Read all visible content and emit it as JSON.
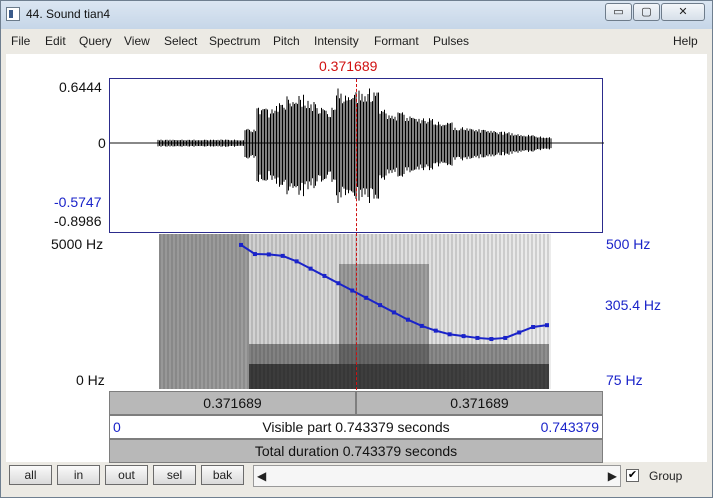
{
  "window": {
    "title": "44. Sound tian4",
    "buttons": {
      "min": "▭",
      "max": "▢",
      "close": "✕"
    }
  },
  "menu": [
    "File",
    "Edit",
    "Query",
    "View",
    "Select",
    "Spectrum",
    "Pitch",
    "Intensity",
    "Formant",
    "Pulses",
    "Help"
  ],
  "cursor_time": "0.371689",
  "waveform": {
    "y_max": "0.6444",
    "y_zero": "0",
    "y_min_blue": "-0.5747",
    "y_min": "-0.8986"
  },
  "spectrogram": {
    "left_top": "5000 Hz",
    "left_bottom": "0 Hz",
    "right_top": "500 Hz",
    "right_mid": "305.4 Hz",
    "right_bottom": "75 Hz"
  },
  "pitch_hz_curve": [
    470,
    445,
    444,
    440,
    425,
    405,
    385,
    365,
    345,
    325,
    305,
    285,
    265,
    248,
    235,
    225,
    220,
    215,
    212,
    215,
    230,
    245,
    250
  ],
  "bars": {
    "left_time": "0.371689",
    "right_time": "0.371689",
    "visible_left": "0",
    "visible_label": "Visible part 0.743379 seconds",
    "visible_right": "0.743379",
    "total_label": "Total duration 0.743379 seconds"
  },
  "bottom": {
    "all": "all",
    "in": "in",
    "out": "out",
    "sel": "sel",
    "bak": "bak",
    "group": "Group",
    "group_checked": "✔",
    "left_arrow": "◀",
    "right_arrow": "▶"
  },
  "colors": {
    "accent_red": "#d01010",
    "pitch_blue": "#1a23c9"
  }
}
